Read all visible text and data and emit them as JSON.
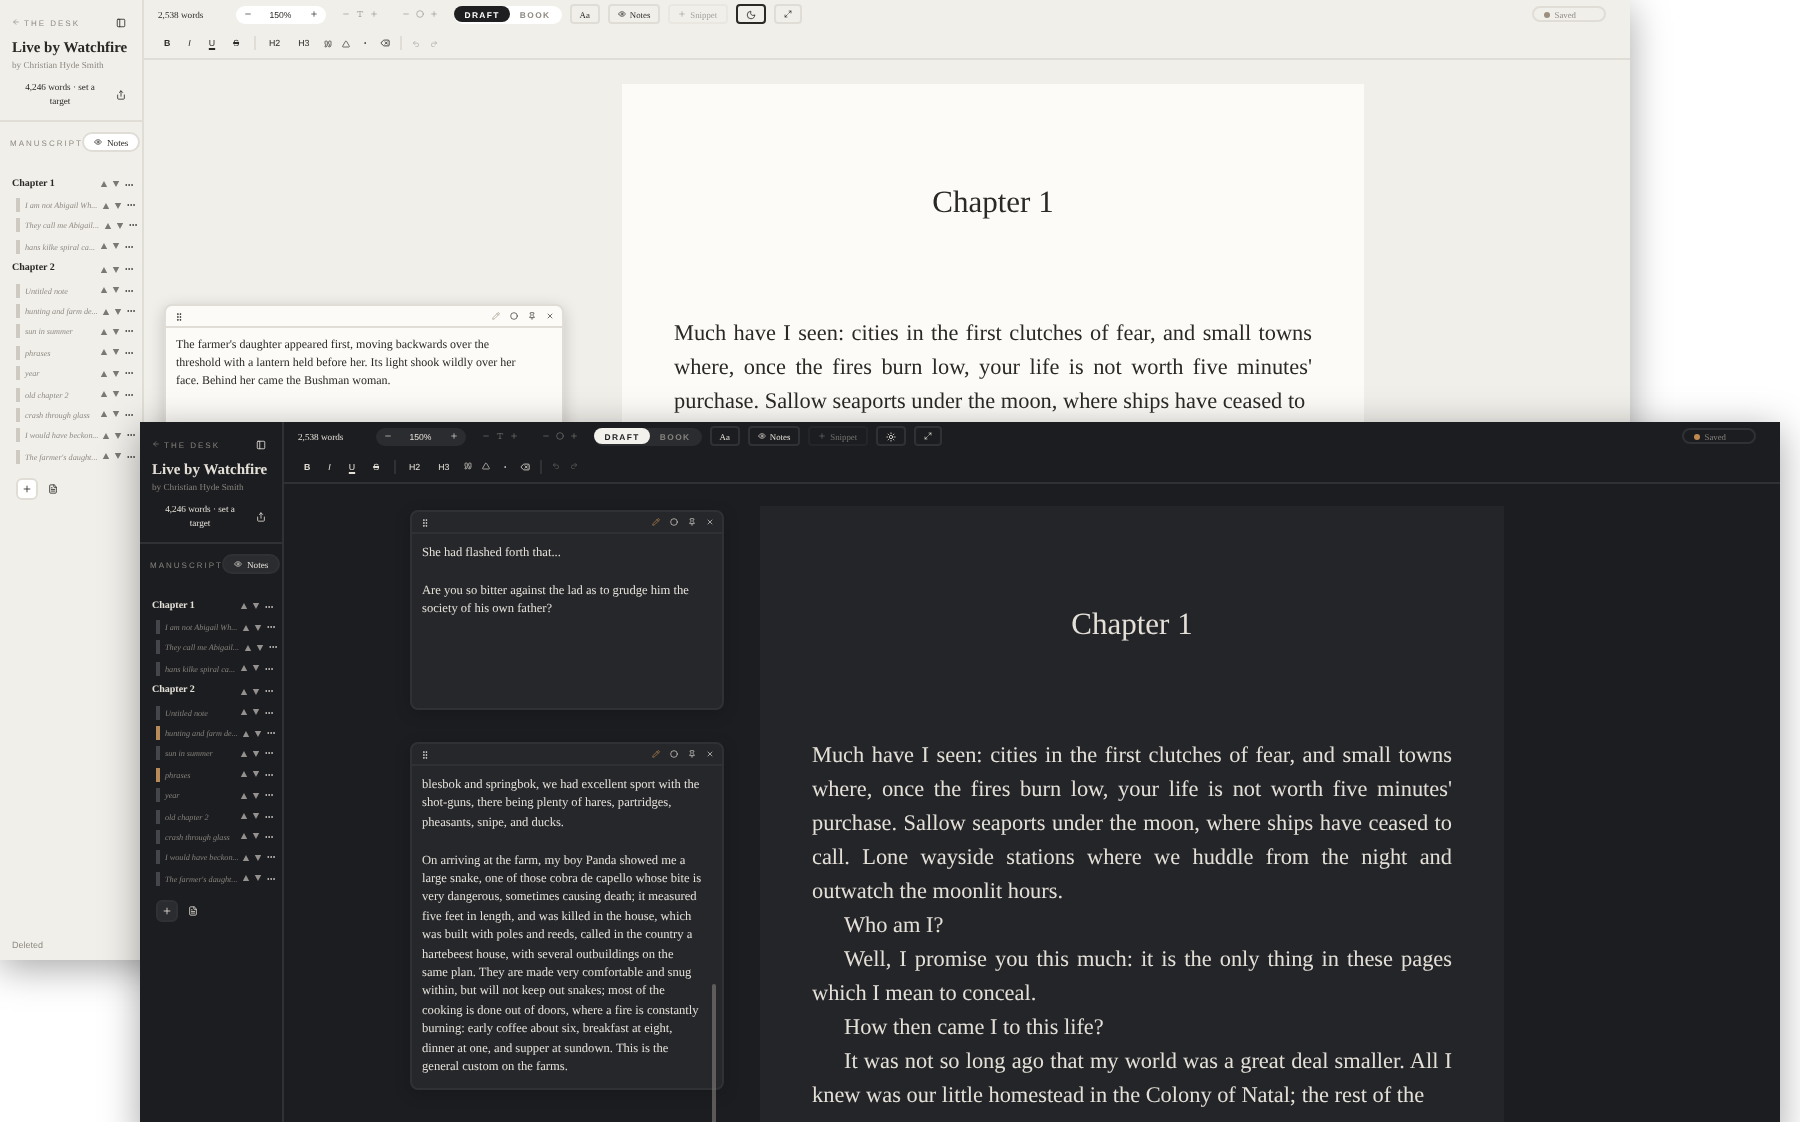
{
  "windows": [
    {
      "kind": "light",
      "sidebar": {
        "back_label": "THE DESK",
        "title": "Live by Watchfire",
        "author": "by Christian Hyde Smith",
        "stats": "4,246 words · set a target",
        "section_label": "MANUSCRIPT",
        "notes_button": "Notes",
        "chapters": [
          {
            "title": "Chapter 1",
            "items": [
              {
                "title": "I am not Abigail Wh...",
                "color": "#cfcac1"
              },
              {
                "title": "They call me Abigail...",
                "color": "#cfcac1"
              },
              {
                "title": "hans kilke spiral ca...",
                "color": "#cfcac1"
              }
            ]
          },
          {
            "title": "Chapter 2",
            "items": [
              {
                "title": "Untitled note",
                "color": "#cfcac1"
              },
              {
                "title": "hunting and farm de...",
                "color": "#cfcac1"
              },
              {
                "title": "sun in summer",
                "color": "#cfcac1"
              },
              {
                "title": "phrases",
                "color": "#cfcac1"
              },
              {
                "title": "year",
                "color": "#cfcac1"
              },
              {
                "title": "old chapter 2",
                "color": "#cfcac1"
              },
              {
                "title": "crash through glass",
                "color": "#cfcac1"
              },
              {
                "title": "I would have beckon...",
                "color": "#cfcac1"
              },
              {
                "title": "The farmer's daught...",
                "color": "#cfcac1"
              }
            ]
          }
        ],
        "footer": "Deleted"
      },
      "toolbar": {
        "word_count": "2,538 words",
        "zoom": "150%",
        "modes": [
          {
            "label": "DRAFT",
            "selected": true
          },
          {
            "label": "BOOK",
            "selected": false
          }
        ],
        "font_button": "Aa",
        "notes_button": "Notes",
        "snippet_button": {
          "label": "Snippet",
          "disabled": true
        },
        "status": "Saved",
        "format_buttons": [
          "B",
          "I",
          "U",
          "S",
          "H2",
          "H3"
        ]
      },
      "notes": [
        {
          "lines": [
            "The farmer's daughter appeared first, moving backwards over the",
            "threshold with a lantern held before her. Its light shook wildly over her",
            "face. Behind her came the Bushman woman."
          ]
        }
      ],
      "page": {
        "title": "Chapter 1",
        "paragraphs": [
          {
            "lines": [
              "Much have I seen: cities in the first clutches of fear, and small towns",
              "where, once the fires burn low, your life is not worth five minutes'",
              "purchase. Sallow seaports under the moon, where ships have ceased to"
            ]
          }
        ]
      }
    },
    {
      "kind": "dark",
      "sidebar": {
        "back_label": "THE DESK",
        "title": "Live by Watchfire",
        "author": "by Christian Hyde Smith",
        "stats": "4,246 words · set a target",
        "section_label": "MANUSCRIPT",
        "notes_button": "Notes",
        "chapters": [
          {
            "title": "Chapter 1",
            "items": [
              {
                "title": "I am not Abigail Wh...",
                "color": "#45464b"
              },
              {
                "title": "They call me Abigail...",
                "color": "#45464b"
              },
              {
                "title": "hans kilke spiral ca...",
                "color": "#45464b"
              }
            ]
          },
          {
            "title": "Chapter 2",
            "items": [
              {
                "title": "Untitled note",
                "color": "#45464b"
              },
              {
                "title": "hunting and farm de...",
                "color": "#b88a58"
              },
              {
                "title": "sun in summer",
                "color": "#45464b"
              },
              {
                "title": "phrases",
                "color": "#b88a58"
              },
              {
                "title": "year",
                "color": "#45464b"
              },
              {
                "title": "old chapter 2",
                "color": "#45464b"
              },
              {
                "title": "crash through glass",
                "color": "#45464b"
              },
              {
                "title": "I would have beckon...",
                "color": "#45464b"
              },
              {
                "title": "The farmer's daught...",
                "color": "#45464b"
              }
            ]
          }
        ]
      },
      "toolbar": {
        "word_count": "2,538 words",
        "zoom": "150%",
        "modes": [
          {
            "label": "DRAFT",
            "selected": true
          },
          {
            "label": "BOOK",
            "selected": false
          }
        ],
        "font_button": "Aa",
        "notes_button": "Notes",
        "snippet_button": {
          "label": "Snippet",
          "disabled": true
        },
        "status": "Saved",
        "format_buttons": [
          "B",
          "I",
          "U",
          "S",
          "H2",
          "H3"
        ]
      },
      "notes": [
        {
          "paragraphs": [
            "She had flashed forth that...",
            "Are you so bitter against the lad as to grudge him the society of his own father?"
          ]
        },
        {
          "paragraphs": [
            "blesbok and springbok, we had excellent sport with the shot-guns, there being plenty of hares, partridges, pheasants, snipe, and ducks.",
            "On arriving at the farm, my boy Panda showed me a large snake, one of those cobra de capello whose bite is very dangerous, sometimes causing death; it measured five feet in length, and was killed in the house, which was built with poles and reeds, called in the country a hartebeest house, with several outbuildings on the same plan. They are made very comfortable and snug within, but will not keep out snakes; most of the cooking is done out of doors, where a fire is constantly burning: early coffee about six, breakfast at eight, dinner at one, and supper at sundown. This is the general custom on the farms."
          ]
        }
      ],
      "page": {
        "title": "Chapter 1",
        "paragraphs": [
          {
            "lines": [
              "Much have I seen: cities in the first clutches of fear, and small towns",
              "where, once the fires burn low, your life is not worth five minutes'",
              "purchase. Sallow seaports under the moon, where ships have ceased to",
              "call. Lone wayside stations where we huddle from the night and",
              "outwatch the moonlit hours."
            ]
          },
          {
            "lines": [
              "Who am I?"
            ]
          },
          {
            "lines": [
              "Well, I promise you this much: it is the only thing in these pages",
              "which I mean to conceal."
            ]
          },
          {
            "lines": [
              "How then came I to this life?"
            ]
          },
          {
            "lines": [
              "It was not so long ago that my world was a great deal smaller. All I",
              "knew was our little homestead in the Colony of Natal; the rest of the"
            ]
          }
        ]
      }
    }
  ]
}
